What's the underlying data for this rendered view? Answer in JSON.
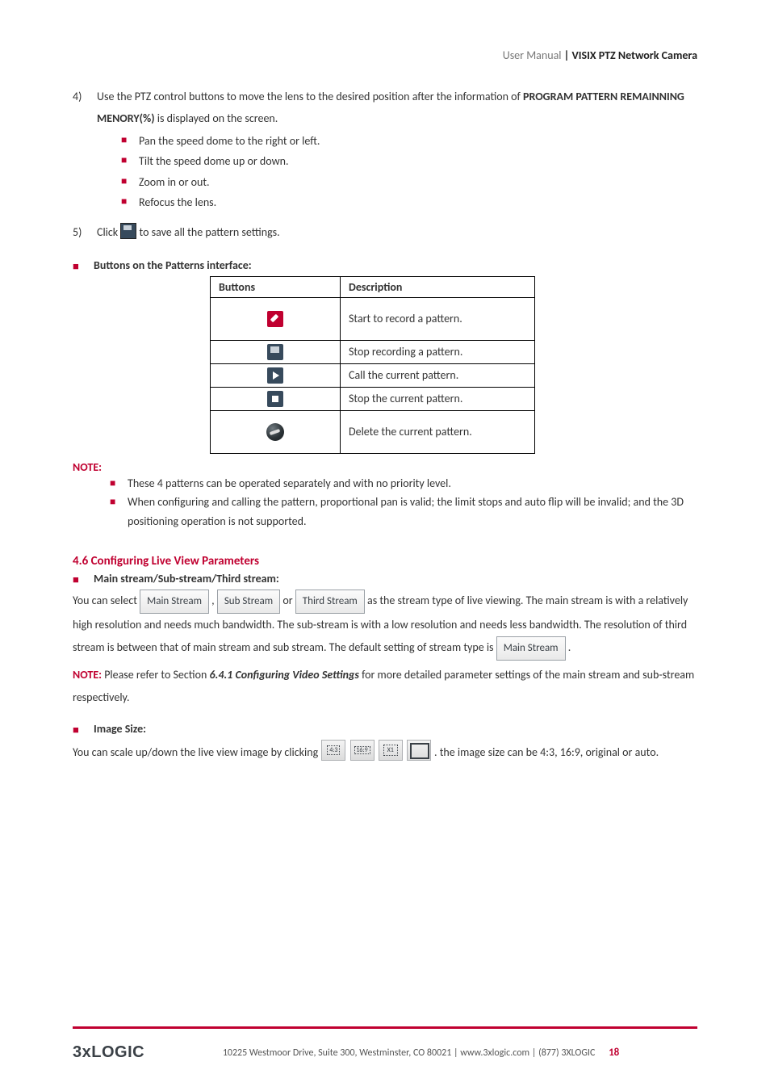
{
  "header": {
    "grey": "User Manual",
    "bold": " | VISIX PTZ Network Camera"
  },
  "step4": {
    "num": "4)",
    "text_a": "Use the PTZ control buttons to move the lens to the desired position after the information of ",
    "bold": "PROGRAM PATTERN REMAINNING MENORY(%)",
    "text_b": " is displayed on the screen.",
    "bullets": [
      "Pan the speed dome to the right or left.",
      "Tilt the speed dome up or down.",
      "Zoom in or out.",
      "Refocus the lens."
    ]
  },
  "step5": {
    "num": "5)",
    "pre": "Click ",
    "post": " to save all the pattern settings."
  },
  "patterns": {
    "heading": "Buttons on the Patterns interface:",
    "th_buttons": "Buttons",
    "th_desc": "Description",
    "rows": [
      {
        "desc": "Start to record a pattern."
      },
      {
        "desc": "Stop recording a pattern."
      },
      {
        "desc": "Call the current pattern."
      },
      {
        "desc": "Stop the current pattern."
      },
      {
        "desc": "Delete the current pattern."
      }
    ]
  },
  "note": {
    "label": "NOTE:",
    "items": [
      "These 4 patterns can be operated separately and with no priority level.",
      "When configuring and calling the pattern, proportional pan is valid; the limit stops and auto flip will be invalid; and the 3D positioning operation is not supported."
    ]
  },
  "sec46": {
    "num": "4.6",
    "title": " Configuring Live View Parameters",
    "streams_heading": "Main stream/Sub-stream/Third stream:",
    "p1_a": "You can select ",
    "chip_main": "Main Stream",
    "p1_b": ", ",
    "chip_sub": "Sub Stream",
    "p1_c": " or ",
    "chip_third": "Third Stream",
    "p1_d": " as the stream type of live viewing. The main stream is with a relatively high resolution and needs much bandwidth. The sub-stream is with a low resolution and needs less bandwidth. The resolution of third stream is between that of main stream and sub stream. The default setting of stream type is ",
    "chip_main2": "Main Stream",
    "p1_e": ".",
    "note_label": "NOTE:",
    "note_a": " Please refer to Section ",
    "note_ref": "6.4.1 Configuring Video Settings",
    "note_b": " for more detailed parameter settings of the main stream and sub-stream respectively.",
    "imgsize_heading": "Image Size:",
    "img_a": "You can scale up/down the live view image by clicking ",
    "btn43": "4:3",
    "btn169": "16:9",
    "btnx1": "X1",
    "img_b": " . the image size can be 4:3, 16:9, original or auto."
  },
  "footer": {
    "logo": "3xLOGIC",
    "text": "10225 Westmoor Drive, Suite 300, Westminster, CO 80021 | www.3xlogic.com | (877) 3XLOGIC",
    "page": "18"
  }
}
